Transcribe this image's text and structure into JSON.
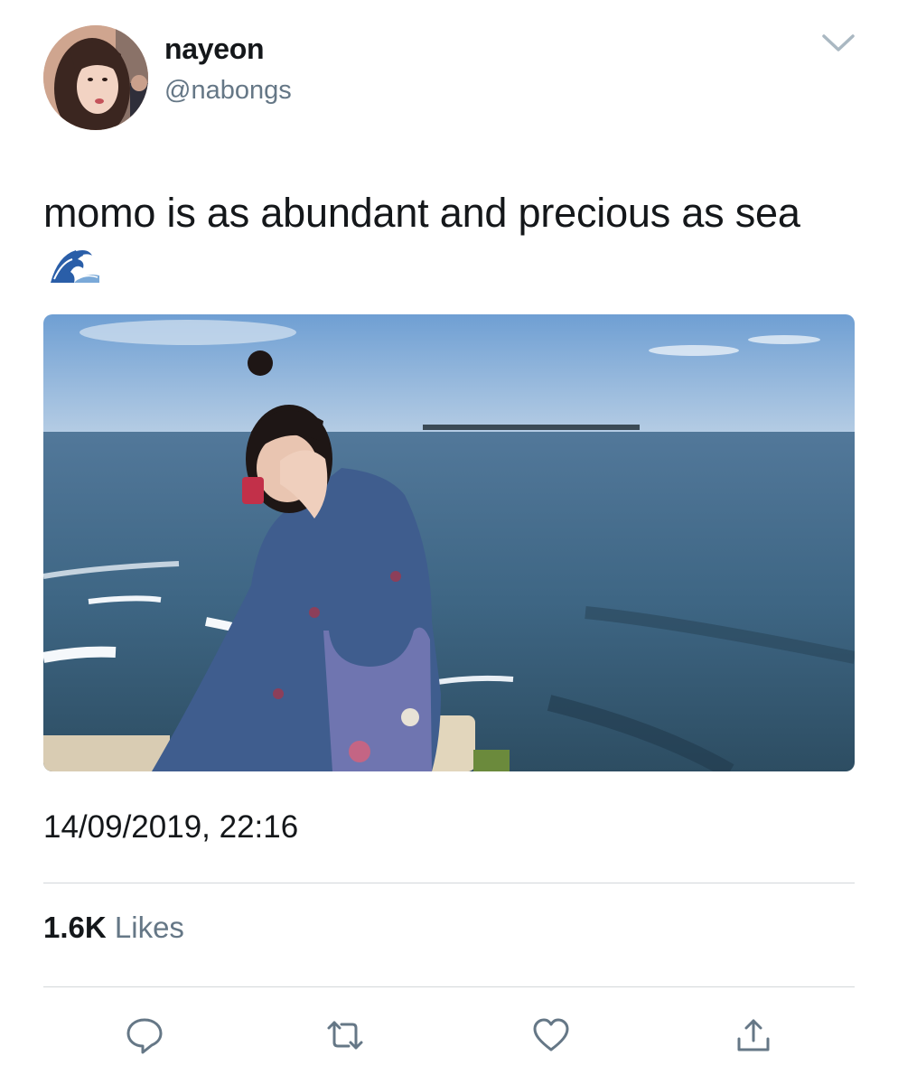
{
  "user": {
    "display_name": "nayeon",
    "handle": "@nabongs"
  },
  "tweet": {
    "text": "momo is as abundant and precious as sea",
    "emoji": "water-wave-emoji",
    "timestamp": "14/09/2019, 22:16"
  },
  "stats": {
    "likes_count": "1.6K",
    "likes_label": "Likes"
  },
  "actions": {
    "icons": [
      "reply-icon",
      "retweet-icon",
      "like-icon",
      "share-icon"
    ]
  },
  "colors": {
    "text_primary": "#14171a",
    "text_secondary": "#657786",
    "divider": "#d3d7da",
    "icon": "#657786"
  }
}
